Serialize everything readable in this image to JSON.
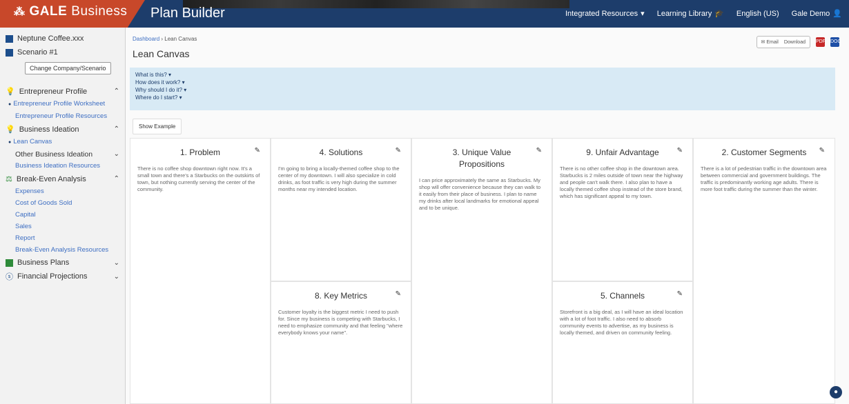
{
  "header": {
    "brand_bold": "GALE",
    "brand_light": "Business",
    "app_title": "Plan Builder",
    "links": [
      {
        "label": "Integrated Resources",
        "icon": "chevron-down-icon"
      },
      {
        "label": "Learning Library",
        "icon": "graduation-cap-icon"
      },
      {
        "label": "English (US)",
        "icon": ""
      },
      {
        "label": "Gale Demo",
        "icon": "user-icon"
      }
    ]
  },
  "sidebar": {
    "company": "Neptune Coffee.xxx",
    "scenario": "Scenario #1",
    "change_button": "Change Company/Scenario",
    "sections": [
      {
        "label": "Entrepreneur Profile",
        "expanded": true,
        "items": [
          {
            "label": "Entrepreneur Profile Worksheet",
            "active": true
          },
          {
            "label": "Entrepreneur Profile Resources",
            "active": false
          }
        ]
      },
      {
        "label": "Business Ideation",
        "expanded": true,
        "items": [
          {
            "label": "Lean Canvas",
            "active": true
          },
          {
            "label": "Other Business Ideation",
            "active": false,
            "plain": true
          },
          {
            "label": "Business Ideation Resources",
            "active": false
          }
        ]
      },
      {
        "label": "Break-Even Analysis",
        "expanded": true,
        "items": [
          {
            "label": "Expenses",
            "active": false
          },
          {
            "label": "Cost of Goods Sold",
            "active": false
          },
          {
            "label": "Capital",
            "active": false
          },
          {
            "label": "Sales",
            "active": false
          },
          {
            "label": "Report",
            "active": false
          },
          {
            "label": "Break-Even Analysis Resources",
            "active": false
          }
        ]
      },
      {
        "label": "Business Plans",
        "expanded": false,
        "items": []
      },
      {
        "label": "Financial Projections",
        "expanded": false,
        "items": []
      }
    ]
  },
  "main": {
    "breadcrumb_link": "Dashboard",
    "breadcrumb_current": "Lean Canvas",
    "title": "Lean Canvas",
    "actions": {
      "email": "Email",
      "download": "Download",
      "pdf": "PDF",
      "doc": "DOC"
    },
    "faq": [
      "What is this?",
      "How does it work?",
      "Why should I do it?",
      "Where do I start?"
    ],
    "show_example": "Show Example",
    "cells": {
      "problem": {
        "title": "1. Problem",
        "body": "There is no coffee shop downtown right now. It's a small town and there's a Starbucks on the outskirts of town, but nothing currently serving the center of the community."
      },
      "solutions": {
        "title": "4. Solutions",
        "body": "I'm going to bring a locally-themed coffee shop to the center of my downtown. I will also specialize in cold drinks, as foot traffic is very high during the summer months near my intended location."
      },
      "uvp": {
        "title": "3. Unique Value Propositions",
        "body": "I can price approximately the same as Starbucks. My shop will offer convenience because they can walk to it easily from their place of business. I plan to name my drinks after local landmarks for emotional appeal and to be unique."
      },
      "advantage": {
        "title": "9. Unfair Advantage",
        "body": "There is no other coffee shop in the downtown area. Starbucks is 2 miles outside of town near the highway and people can't walk there. I also plan to have a locally themed coffee shop instead of the store brand, which has significant appeal to my town."
      },
      "segments": {
        "title": "2. Customer Segments",
        "body": "There is a lot of pedestrian traffic in the downtown area between commercial and government buildings. The traffic is predominantly working age adults. There is more foot traffic during the summer than the winter."
      },
      "metrics": {
        "title": "8. Key Metrics",
        "body": "Customer loyalty is the biggest metric I need to push for. Since my business is competing with Starbucks, I need to emphasize community and that feeling \"where everybody knows your name\"."
      },
      "channels": {
        "title": "5. Channels",
        "body": "Storefront is a big deal, as I will have an ideal location with a lot of foot traffic. I also need to absorb community events to advertise, as my business is locally themed, and driven on community feeling."
      }
    }
  }
}
